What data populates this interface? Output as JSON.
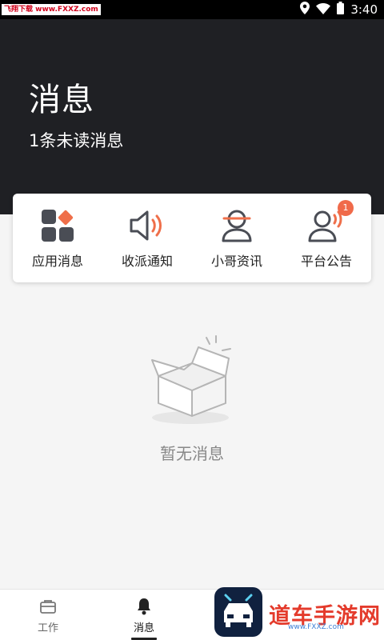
{
  "status_bar": {
    "watermark": "飞翔下载 www.FXXZ.com",
    "time": "3:40"
  },
  "header": {
    "title": "消息",
    "unread": "1条未读消息"
  },
  "categories": [
    {
      "label": "应用消息",
      "icon": "app-grid-icon"
    },
    {
      "label": "收派通知",
      "icon": "speaker-icon"
    },
    {
      "label": "小哥资讯",
      "icon": "courier-icon"
    },
    {
      "label": "平台公告",
      "icon": "announcement-icon",
      "badge": "1"
    }
  ],
  "empty": {
    "text": "暂无消息",
    "icon": "empty-box-icon"
  },
  "tabbar": {
    "tabs": [
      {
        "label": "工作",
        "icon": "briefcase-icon"
      },
      {
        "label": "消息",
        "icon": "bell-icon",
        "active": true
      }
    ]
  },
  "watermark_bottom": {
    "main": "道车手游网",
    "sub": "www.FXXZ.com"
  },
  "colors": {
    "header_bg": "#1f2024",
    "accent": "#f06a4a",
    "icon_dark": "#4a4d55"
  }
}
